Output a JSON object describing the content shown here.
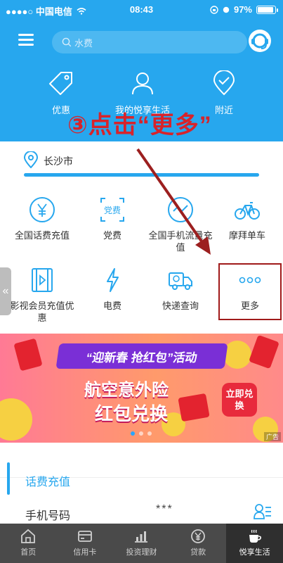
{
  "status_bar": {
    "carrier": "●●●●○ 中国电信",
    "time": "08:43",
    "battery": "97%"
  },
  "header": {
    "search_placeholder": "水费",
    "quick_actions": [
      {
        "label": "优惠"
      },
      {
        "label": "我的悦享生活"
      },
      {
        "label": "附近"
      }
    ]
  },
  "overlay_instruction": "③点击“更多”",
  "location": {
    "city": "长沙市"
  },
  "services": [
    {
      "label": "全国话费充值",
      "badge": ""
    },
    {
      "label": "党费",
      "badge": "党费"
    },
    {
      "label": "全国手机流量充值",
      "badge": ""
    },
    {
      "label": "摩拜单车",
      "badge": ""
    },
    {
      "label": "影视会员充值优惠",
      "badge": ""
    },
    {
      "label": "电费",
      "badge": ""
    },
    {
      "label": "快递查询",
      "badge": ""
    },
    {
      "label": "更多",
      "badge": ""
    }
  ],
  "banner": {
    "ribbon": "“迎新春  抢红包”活动",
    "line1": "航空意外险",
    "line2": "红包兑换",
    "cta": "立即兑换",
    "ad_tag": "广告"
  },
  "recharge": {
    "title": "话费充值",
    "phone_label": "手机号码",
    "phone_value": "***"
  },
  "tabbar": [
    {
      "label": "首页",
      "icon": "home-icon"
    },
    {
      "label": "信用卡",
      "icon": "credit-card-icon"
    },
    {
      "label": "投资理财",
      "icon": "chart-icon"
    },
    {
      "label": "贷款",
      "icon": "yen-icon"
    },
    {
      "label": "悦享生活",
      "icon": "coffee-icon"
    }
  ],
  "colors": {
    "primary": "#27a7ee",
    "annotation": "#d8232a",
    "tabbar": "#4a4a4a"
  }
}
